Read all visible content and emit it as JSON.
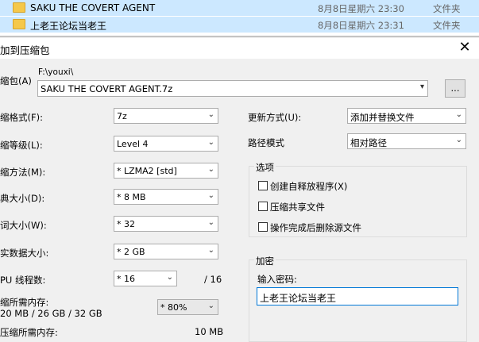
{
  "explorer": {
    "rows": [
      {
        "name": "SAKU THE COVERT AGENT",
        "date": "8月8日星期六 23:30",
        "type": "文件夹"
      },
      {
        "name": "上老王论坛当老王",
        "date": "8月8日星期六 23:31",
        "type": "文件夹"
      }
    ]
  },
  "dialog": {
    "title": "加到压缩包",
    "close_glyph": "✕",
    "archive_label": "缩包(A)",
    "archive_path": "F:\\youxi\\",
    "archive_name": "SAKU THE COVERT AGENT.7z",
    "browse_label": "...",
    "format": {
      "label": "缩格式(F):",
      "value": "7z"
    },
    "level": {
      "label": "缩等级(L):",
      "value": "Level 4"
    },
    "method": {
      "label": "缩方法(M):",
      "value": "* LZMA2 [std]"
    },
    "dict": {
      "label": "典大小(D):",
      "value": "* 8 MB"
    },
    "word": {
      "label": "词大小(W):",
      "value": "* 32"
    },
    "solid": {
      "label": "实数据大小:",
      "value": "* 2 GB"
    },
    "threads": {
      "label": "PU 线程数:",
      "value": "* 16",
      "max": "/ 16"
    },
    "mem_usage": {
      "label": "缩所需内存:",
      "detail": "20 MB / 26 GB / 32 GB",
      "value": "* 80%"
    },
    "decomp_mem": {
      "label": "压缩所需内存:",
      "value": "10 MB"
    },
    "update_mode": {
      "label": "更新方式(U):",
      "value": "添加并替换文件"
    },
    "path_mode": {
      "label": "路径模式",
      "value": "相对路径"
    },
    "options": {
      "title": "选项",
      "items": [
        {
          "label": "创建自释放程序(X)",
          "checked": false
        },
        {
          "label": "压缩共享文件",
          "checked": false
        },
        {
          "label": "操作完成后删除源文件",
          "checked": false
        }
      ]
    },
    "encryption": {
      "title": "加密",
      "password_label": "输入密码:",
      "password_value": "上老王论坛当老王"
    }
  }
}
